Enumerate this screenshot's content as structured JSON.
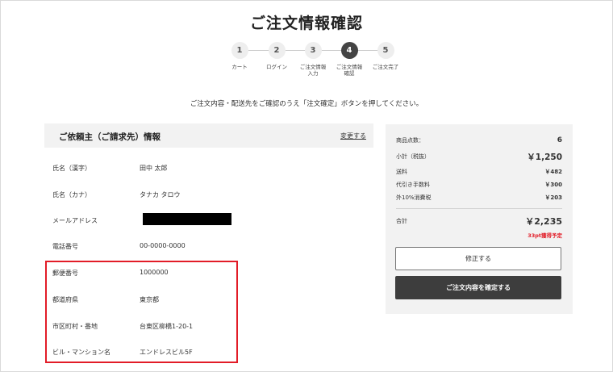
{
  "page": {
    "title": "ご注文情報確認"
  },
  "steps": [
    {
      "number": "1",
      "label": "カート"
    },
    {
      "number": "2",
      "label": "ログイン"
    },
    {
      "number": "3",
      "label": "ご注文情報\n入力"
    },
    {
      "number": "4",
      "label": "ご注文情報\n確認"
    },
    {
      "number": "5",
      "label": "ご注文完了"
    }
  ],
  "active_step": 4,
  "instruction": "ご注文内容・配送先をご確認のうえ「注文確定」ボタンを押してください。",
  "requester": {
    "title": "ご依頼主（ご請求先）情報",
    "change_link": "変更する",
    "rows": [
      {
        "label": "氏名（漢字）",
        "value": "田中 太郎"
      },
      {
        "label": "氏名（カナ）",
        "value": "タナカ タロウ"
      },
      {
        "label": "メールアドレス",
        "value": ""
      },
      {
        "label": "電話番号",
        "value": "00-0000-0000"
      },
      {
        "label": "郵便番号",
        "value": "1000000"
      },
      {
        "label": "都道府県",
        "value": "東京都"
      },
      {
        "label": "市区町村・番地",
        "value": "台東区柳橋1-20-1"
      },
      {
        "label": "ビル・マンション名",
        "value": "エンドレスビル5F"
      }
    ]
  },
  "summary": {
    "count_label": "商品点数：",
    "count_value": "6",
    "subtotal_label": "小計（税抜）",
    "subtotal_value": "￥1,250",
    "shipping_label": "送料",
    "shipping_value": "￥482",
    "cod_label": "代引き手数料",
    "cod_value": "￥300",
    "tax_label": "外10%消費税",
    "tax_value": "￥203",
    "total_label": "合計",
    "total_value": "￥2,235",
    "points": "33pt獲得予定",
    "fix_button": "修正する",
    "confirm_button": "ご注文内容を確定する"
  },
  "colors": {
    "accent_red": "#e21c27",
    "dark_button": "#3d3d3d",
    "panel_bg": "#f2f2f2"
  }
}
